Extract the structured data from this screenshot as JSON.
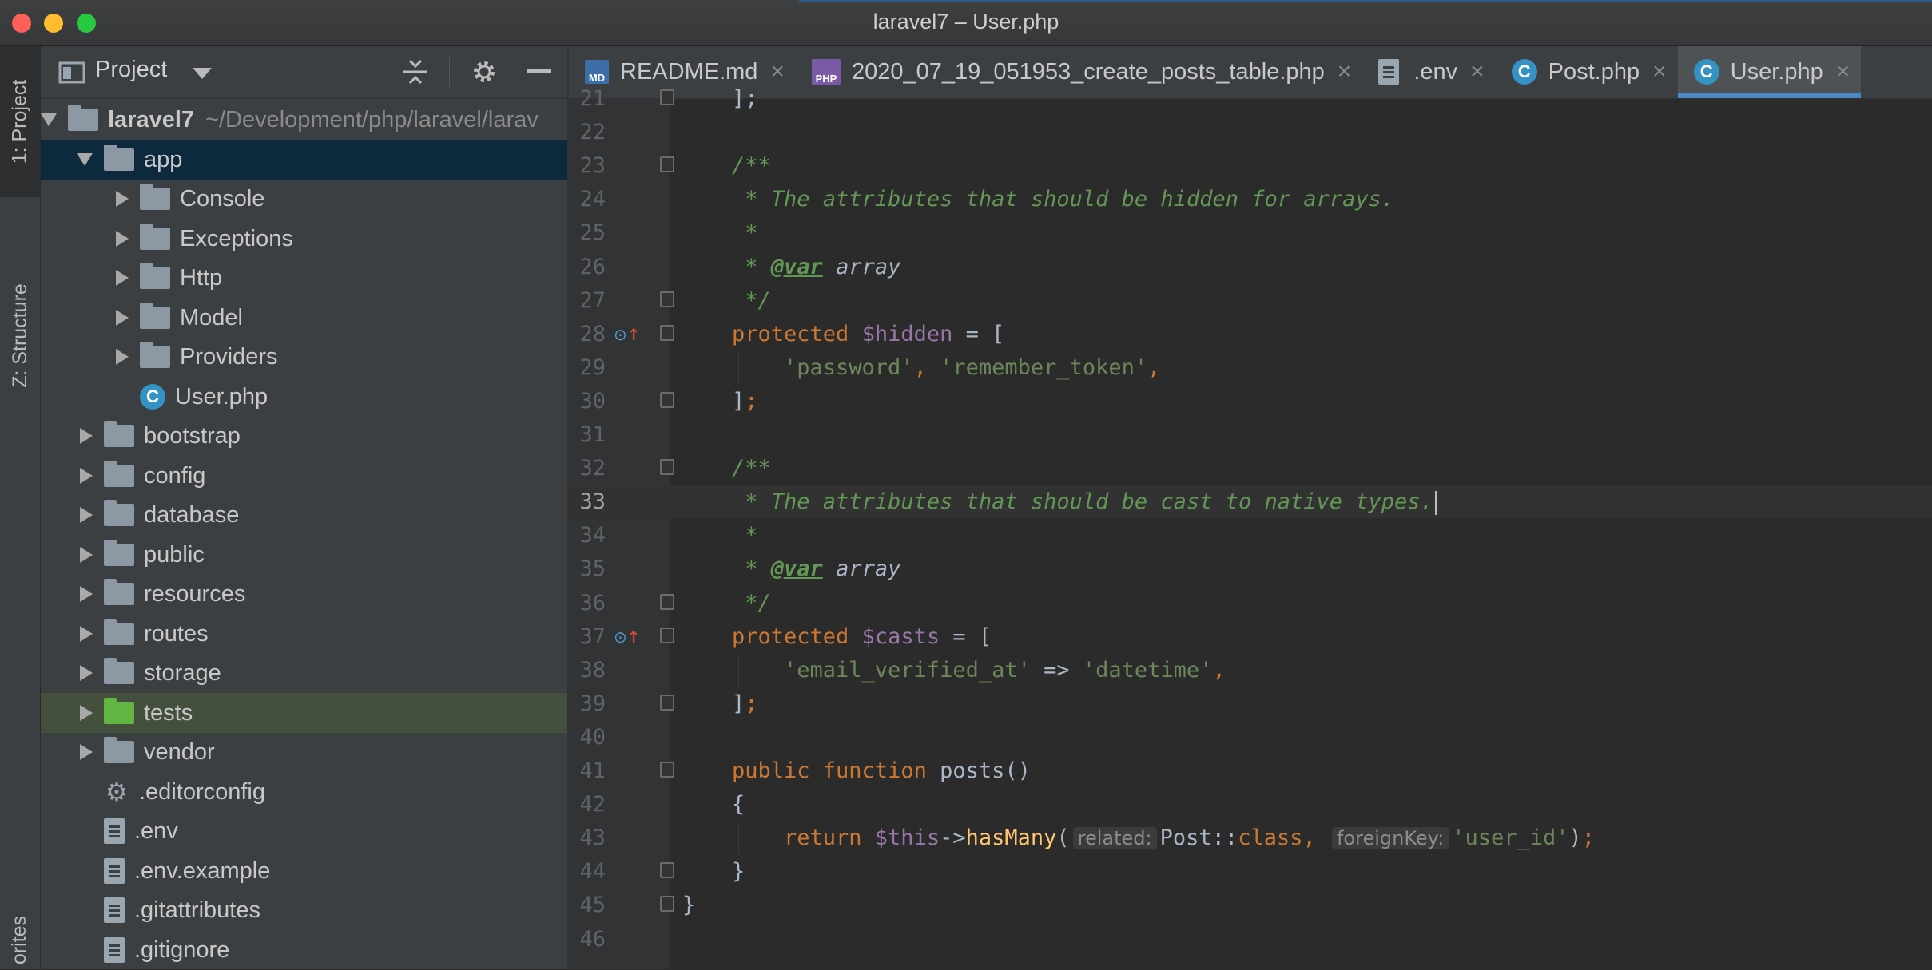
{
  "window": {
    "title": "laravel7 – User.php"
  },
  "toolstrip": {
    "project_tab": "1: Project",
    "structure_tab": "Z: Structure",
    "favorites_tab": "orites"
  },
  "project_panel": {
    "title": "Project",
    "tree": [
      {
        "label": "laravel7",
        "path": "~/Development/php/laravel/larav",
        "kind": "folder",
        "depth": 0,
        "expanded": true,
        "bold": true
      },
      {
        "label": "app",
        "kind": "folder",
        "depth": 1,
        "expanded": true,
        "selected": true
      },
      {
        "label": "Console",
        "kind": "folder",
        "depth": 2,
        "expanded": false
      },
      {
        "label": "Exceptions",
        "kind": "folder",
        "depth": 2,
        "expanded": false
      },
      {
        "label": "Http",
        "kind": "folder",
        "depth": 2,
        "expanded": false
      },
      {
        "label": "Model",
        "kind": "folder",
        "depth": 2,
        "expanded": false
      },
      {
        "label": "Providers",
        "kind": "folder",
        "depth": 2,
        "expanded": false
      },
      {
        "label": "User.php",
        "kind": "class",
        "depth": 2
      },
      {
        "label": "bootstrap",
        "kind": "folder",
        "depth": 1,
        "expanded": false
      },
      {
        "label": "config",
        "kind": "folder",
        "depth": 1,
        "expanded": false
      },
      {
        "label": "database",
        "kind": "folder",
        "depth": 1,
        "expanded": false
      },
      {
        "label": "public",
        "kind": "folder",
        "depth": 1,
        "expanded": false
      },
      {
        "label": "resources",
        "kind": "folder",
        "depth": 1,
        "expanded": false
      },
      {
        "label": "routes",
        "kind": "folder",
        "depth": 1,
        "expanded": false
      },
      {
        "label": "storage",
        "kind": "folder",
        "depth": 1,
        "expanded": false
      },
      {
        "label": "tests",
        "kind": "folder-green",
        "depth": 1,
        "expanded": false,
        "highlight": true
      },
      {
        "label": "vendor",
        "kind": "folder",
        "depth": 1,
        "expanded": false
      },
      {
        "label": ".editorconfig",
        "kind": "gear",
        "depth": 1
      },
      {
        "label": ".env",
        "kind": "file",
        "depth": 1
      },
      {
        "label": ".env.example",
        "kind": "file",
        "depth": 1
      },
      {
        "label": ".gitattributes",
        "kind": "file",
        "depth": 1
      },
      {
        "label": ".gitignore",
        "kind": "file",
        "depth": 1
      }
    ]
  },
  "tabs": [
    {
      "label": "README.md",
      "icon": "markdown-icon",
      "active": false
    },
    {
      "label": "2020_07_19_051953_create_posts_table.php",
      "icon": "php-file-icon",
      "active": false
    },
    {
      "label": ".env",
      "icon": "text-file-icon",
      "active": false
    },
    {
      "label": "Post.php",
      "icon": "class-icon",
      "active": false
    },
    {
      "label": "User.php",
      "icon": "class-icon",
      "active": true
    }
  ],
  "editor": {
    "current_line": 33,
    "lines": [
      {
        "n": "21",
        "indent": 1,
        "fold": true,
        "tokens": [
          [
            "plain",
            "];"
          ]
        ]
      },
      {
        "n": "22",
        "indent": 0,
        "tokens": []
      },
      {
        "n": "23",
        "indent": 1,
        "fold": true,
        "tokens": [
          [
            "doc",
            "/**"
          ]
        ]
      },
      {
        "n": "24",
        "indent": 1,
        "tokens": [
          [
            "doc",
            " * The attributes that should be hidden for arrays."
          ]
        ]
      },
      {
        "n": "25",
        "indent": 1,
        "tokens": [
          [
            "doc",
            " *"
          ]
        ]
      },
      {
        "n": "26",
        "indent": 1,
        "tokens": [
          [
            "doc",
            " * "
          ],
          [
            "doctag",
            "@var"
          ],
          [
            "doctype",
            " array"
          ]
        ]
      },
      {
        "n": "27",
        "indent": 1,
        "fold": true,
        "tokens": [
          [
            "doc",
            " */"
          ]
        ]
      },
      {
        "n": "28",
        "indent": 1,
        "fold": true,
        "override": true,
        "tokens": [
          [
            "kw",
            "protected "
          ],
          [
            "var",
            "$hidden"
          ],
          [
            "plain",
            " = ["
          ]
        ]
      },
      {
        "n": "29",
        "indent": 2,
        "tokens": [
          [
            "str",
            "'password'"
          ],
          [
            "kw",
            ", "
          ],
          [
            "str",
            "'remember_token'"
          ],
          [
            "kw",
            ","
          ]
        ]
      },
      {
        "n": "30",
        "indent": 1,
        "fold": true,
        "tokens": [
          [
            "plain",
            "]"
          ],
          [
            "kw",
            ";"
          ]
        ]
      },
      {
        "n": "31",
        "indent": 0,
        "tokens": []
      },
      {
        "n": "32",
        "indent": 1,
        "fold": true,
        "tokens": [
          [
            "doc",
            "/**"
          ]
        ]
      },
      {
        "n": "33",
        "indent": 1,
        "tokens": [
          [
            "doc",
            " * The attributes that should be cast to native types."
          ],
          [
            "caret",
            ""
          ]
        ]
      },
      {
        "n": "34",
        "indent": 1,
        "tokens": [
          [
            "doc",
            " *"
          ]
        ]
      },
      {
        "n": "35",
        "indent": 1,
        "tokens": [
          [
            "doc",
            " * "
          ],
          [
            "doctag",
            "@var"
          ],
          [
            "doctype",
            " array"
          ]
        ]
      },
      {
        "n": "36",
        "indent": 1,
        "fold": true,
        "tokens": [
          [
            "doc",
            " */"
          ]
        ]
      },
      {
        "n": "37",
        "indent": 1,
        "fold": true,
        "override": true,
        "tokens": [
          [
            "kw",
            "protected "
          ],
          [
            "var",
            "$casts"
          ],
          [
            "plain",
            " = ["
          ]
        ]
      },
      {
        "n": "38",
        "indent": 2,
        "tokens": [
          [
            "str",
            "'email_verified_at'"
          ],
          [
            "plain",
            " => "
          ],
          [
            "str",
            "'datetime'"
          ],
          [
            "kw",
            ","
          ]
        ]
      },
      {
        "n": "39",
        "indent": 1,
        "fold": true,
        "tokens": [
          [
            "plain",
            "]"
          ],
          [
            "kw",
            ";"
          ]
        ]
      },
      {
        "n": "40",
        "indent": 0,
        "tokens": []
      },
      {
        "n": "41",
        "indent": 1,
        "fold": true,
        "tokens": [
          [
            "kw",
            "public function "
          ],
          [
            "plain",
            "posts()"
          ]
        ]
      },
      {
        "n": "42",
        "indent": 1,
        "tokens": [
          [
            "plain",
            "{"
          ]
        ]
      },
      {
        "n": "43",
        "indent": 2,
        "tokens": [
          [
            "kw",
            "return "
          ],
          [
            "var",
            "$this"
          ],
          [
            "plain",
            "->"
          ],
          [
            "fn",
            "hasMany"
          ],
          [
            "plain",
            "("
          ],
          [
            "hint",
            "related:"
          ],
          [
            "plain",
            "Post::"
          ],
          [
            "kw",
            "class, "
          ],
          [
            "hint",
            "foreignKey:"
          ],
          [
            "str",
            "'user_id'"
          ],
          [
            "plain",
            ")"
          ],
          [
            "kw",
            ";"
          ]
        ]
      },
      {
        "n": "44",
        "indent": 1,
        "fold": true,
        "tokens": [
          [
            "plain",
            "}"
          ]
        ]
      },
      {
        "n": "45",
        "indent": 0,
        "fold": true,
        "tokens": [
          [
            "plain",
            "}"
          ]
        ]
      },
      {
        "n": "46",
        "indent": 0,
        "tokens": []
      }
    ]
  },
  "colors": {
    "background": "#2b2b2b",
    "keyword": "#cc7832",
    "variable": "#9876aa",
    "string": "#6a8759",
    "doc_comment": "#629755",
    "function": "#ffc66d",
    "accent": "#4a88c7"
  }
}
